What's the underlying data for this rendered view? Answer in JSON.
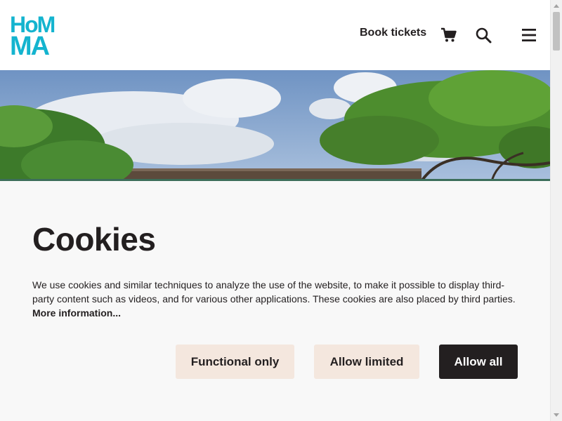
{
  "header": {
    "logo_line1": "HoM",
    "logo_line2": "MA",
    "book_tickets": "Book tickets",
    "icons": {
      "cart": "cart-icon",
      "search": "search-icon",
      "menu": "hamburger-menu-icon"
    }
  },
  "cookie": {
    "title": "Cookies",
    "text": "We use cookies and similar techniques to analyze the use of the website, to make it possible to display third-party content such as videos, and for various other applications. These cookies are also placed by third parties. ",
    "more_link": "More information...",
    "buttons": {
      "functional": "Functional only",
      "limited": "Allow limited",
      "all": "Allow all"
    }
  },
  "colors": {
    "brand": "#14b4cf",
    "text": "#231f20",
    "button_light": "#f4e7de",
    "button_dark": "#231f20",
    "panel_bg": "#f8f8f8"
  }
}
